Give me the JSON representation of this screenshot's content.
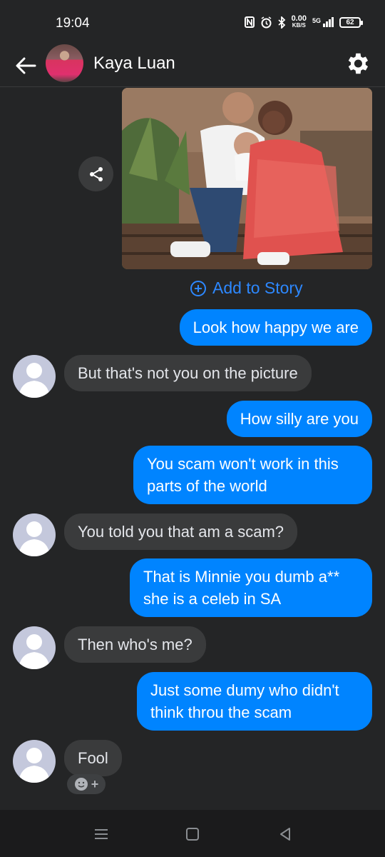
{
  "status_bar": {
    "time": "19:04",
    "speed_value": "0.00",
    "speed_unit": "KB/S",
    "network": "5G",
    "battery": "62"
  },
  "header": {
    "contact_name": "Kaya Luan",
    "back_icon": "arrow-left-icon",
    "settings_icon": "gear-icon"
  },
  "shared_photo": {
    "share_icon": "share-icon",
    "add_to_story_label": "Add to Story"
  },
  "messages": [
    {
      "direction": "outgoing",
      "text": "Look how happy we are"
    },
    {
      "direction": "incoming",
      "text": "But that's not you on the picture"
    },
    {
      "direction": "outgoing",
      "text": "How silly are you"
    },
    {
      "direction": "outgoing",
      "text": "You scam won't work in this parts of the world"
    },
    {
      "direction": "incoming",
      "text": "You told you that am a scam?"
    },
    {
      "direction": "outgoing",
      "text": "That is Minnie you dumb a** she is a celeb in SA"
    },
    {
      "direction": "incoming",
      "text": "Then who's me?"
    },
    {
      "direction": "outgoing",
      "text": "Just some dumy who didn't think throu the scam"
    },
    {
      "direction": "incoming",
      "text": "Fool"
    }
  ],
  "reaction": {
    "icon": "add-reaction-icon",
    "plus": "+"
  },
  "colors": {
    "background": "#242526",
    "outgoing_bubble": "#0084ff",
    "incoming_bubble": "#3a3b3c",
    "accent_link": "#2d88ff"
  }
}
